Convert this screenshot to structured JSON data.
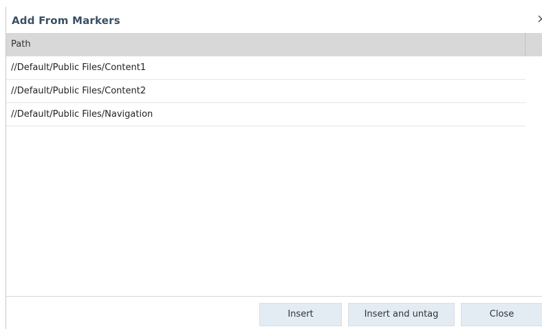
{
  "dialog": {
    "title": "Add From Markers",
    "close_glyph": "×"
  },
  "grid": {
    "columns": [
      {
        "label": "Path"
      }
    ],
    "rows": [
      {
        "path": "//Default/Public Files/Content1"
      },
      {
        "path": "//Default/Public Files/Content2"
      },
      {
        "path": "//Default/Public Files/Navigation"
      }
    ]
  },
  "footer": {
    "insert_label": "Insert",
    "insert_untag_label": "Insert and untag",
    "close_label": "Close"
  }
}
